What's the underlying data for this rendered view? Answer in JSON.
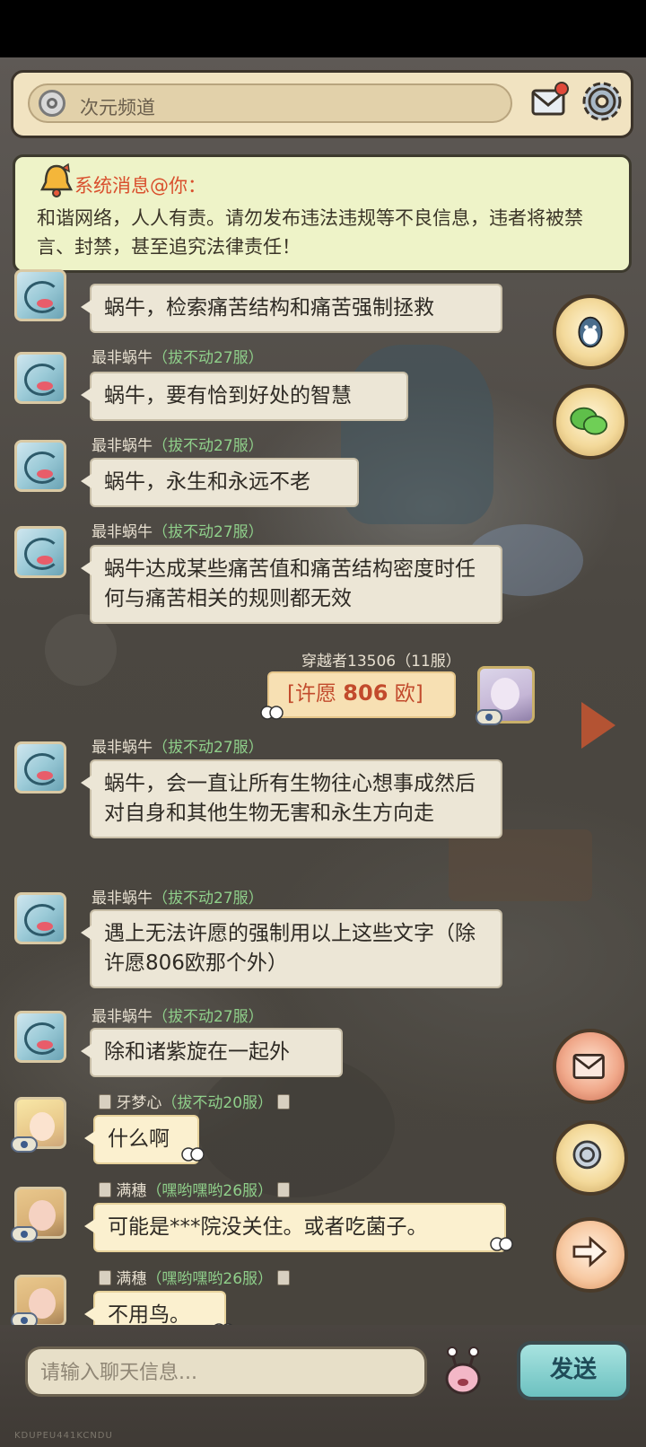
{
  "channel": {
    "title": "次元频道"
  },
  "notice": {
    "title": "系统消息@你：",
    "body": "和谐网络，人人有责。请勿发布违法违规等不良信息，违者将被禁言、封禁，甚至追究法律责任！"
  },
  "messages": [
    {
      "sender": "",
      "server": "",
      "text": "蜗牛，检索痛苦结构和痛苦强制拯救"
    },
    {
      "sender": "最非蜗牛",
      "server": "（拔不动27服）",
      "text": "蜗牛，要有恰到好处的智慧"
    },
    {
      "sender": "最非蜗牛",
      "server": "（拔不动27服）",
      "text": "蜗牛，永生和永远不老"
    },
    {
      "sender": "最非蜗牛",
      "server": "（拔不动27服）",
      "text": "蜗牛达成某些痛苦值和痛苦结构密度时任何与痛苦相关的规则都无效"
    },
    {
      "sender": "穿越者13506",
      "server": "（11服）",
      "wish_prefix": "[许愿",
      "wish_num": "806",
      "wish_suffix": "欧]"
    },
    {
      "sender": "最非蜗牛",
      "server": "（拔不动27服）",
      "text": "蜗牛，会一直让所有生物往心想事成然后对自身和其他生物无害和永生方向走"
    },
    {
      "sender": "最非蜗牛",
      "server": "（拔不动27服）",
      "text": "遇上无法许愿的强制用以上这些文字（除许愿806欧那个外）"
    },
    {
      "sender": "最非蜗牛",
      "server": "（拔不动27服）",
      "text": "除和诸紫旋在一起外"
    },
    {
      "sender": "牙梦心",
      "server": "（拔不动20服）",
      "text": "什么啊"
    },
    {
      "sender": "满穗",
      "server": "（嘿哟嘿哟26服）",
      "text": "可能是***院没关住。或者吃菌子。"
    },
    {
      "sender": "满穗",
      "server": "（嘿哟嘿哟26服）",
      "text": "不用鸟。"
    }
  ],
  "input": {
    "placeholder": "请输入聊天信息..."
  },
  "send": {
    "label": "发送"
  },
  "watermark": "KDUPEU441KCNDU",
  "icons": {
    "channel": "channel-icon",
    "mail": "mail-icon",
    "settings": "gear-icon",
    "bell": "bell-icon",
    "qq": "qq-icon",
    "wechat": "wechat-icon",
    "mailbox": "mail-icon",
    "channel_switch": "channel-switch-icon",
    "next": "arrow-right-icon",
    "emoji": "emoji-icon"
  },
  "colors": {
    "notice_title": "#d9502e",
    "server_tag": "#8fcf8a",
    "wish_text": "#c24a2c",
    "send_button": "#6cc1c0"
  }
}
